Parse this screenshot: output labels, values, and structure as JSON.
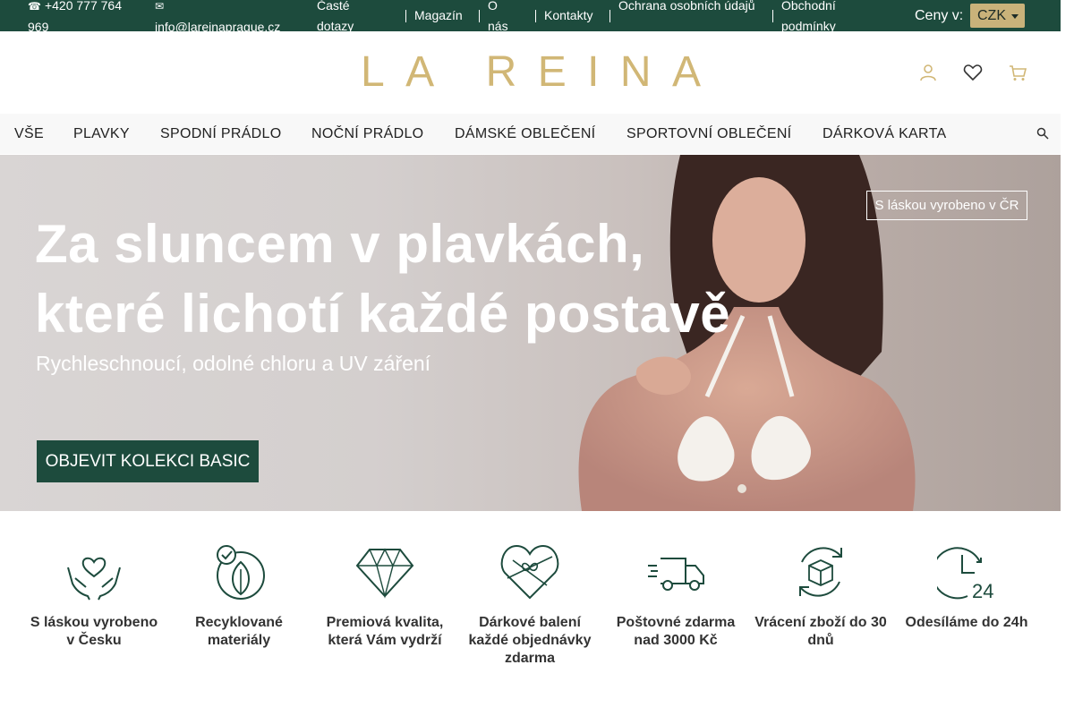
{
  "topbar": {
    "phone": "+420 777 764 969",
    "email": "info@lareinaprague.cz",
    "links": [
      "Časté dotazy",
      "Magazín",
      "O nás",
      "Kontakty",
      "Ochrana osobních údajů",
      "Obchodní podmínky"
    ],
    "currency_label": "Ceny v:",
    "currency_value": "CZK"
  },
  "header": {
    "logo_text": "LA REINA",
    "icons": [
      "user-icon",
      "heart-icon",
      "cart-icon"
    ]
  },
  "nav": {
    "items": [
      "VŠE",
      "PLAVKY",
      "SPODNÍ PRÁDLO",
      "NOČNÍ PRÁDLO",
      "DÁMSKÉ OBLEČENÍ",
      "SPORTOVNÍ OBLEČENÍ",
      "DÁRKOVÁ KARTA"
    ],
    "search_icon": "search-icon"
  },
  "hero": {
    "title_line1": "Za sluncem v plavkách,",
    "title_line2": "které lichotí každé postavě",
    "subtitle": "Rychleschnoucí, odolné chloru a UV záření",
    "cta": "OBJEVIT KOLEKCI BASIC",
    "badge": "S láskou vyrobeno v ČR"
  },
  "features": [
    {
      "icon": "hands-heart-icon",
      "label": "S láskou vyrobeno v Česku"
    },
    {
      "icon": "leaf-check-icon",
      "label": "Recyklované materiály"
    },
    {
      "icon": "diamond-icon",
      "label": "Premiová kvalita, která Vám vydrží"
    },
    {
      "icon": "gift-heart-icon",
      "label": "Dárkové balení každé objednávky zdarma"
    },
    {
      "icon": "delivery-truck-icon",
      "label": "Poštovné zdarma nad 3000 Kč"
    },
    {
      "icon": "return-box-icon",
      "label": "Vrácení zboží do 30 dnů"
    },
    {
      "icon": "clock-24-icon",
      "label": "Odesíláme do 24h"
    }
  ],
  "colors": {
    "brand_green": "#1d4b3d",
    "brand_gold": "#d1b776",
    "currency_button": "#c9b27a"
  }
}
